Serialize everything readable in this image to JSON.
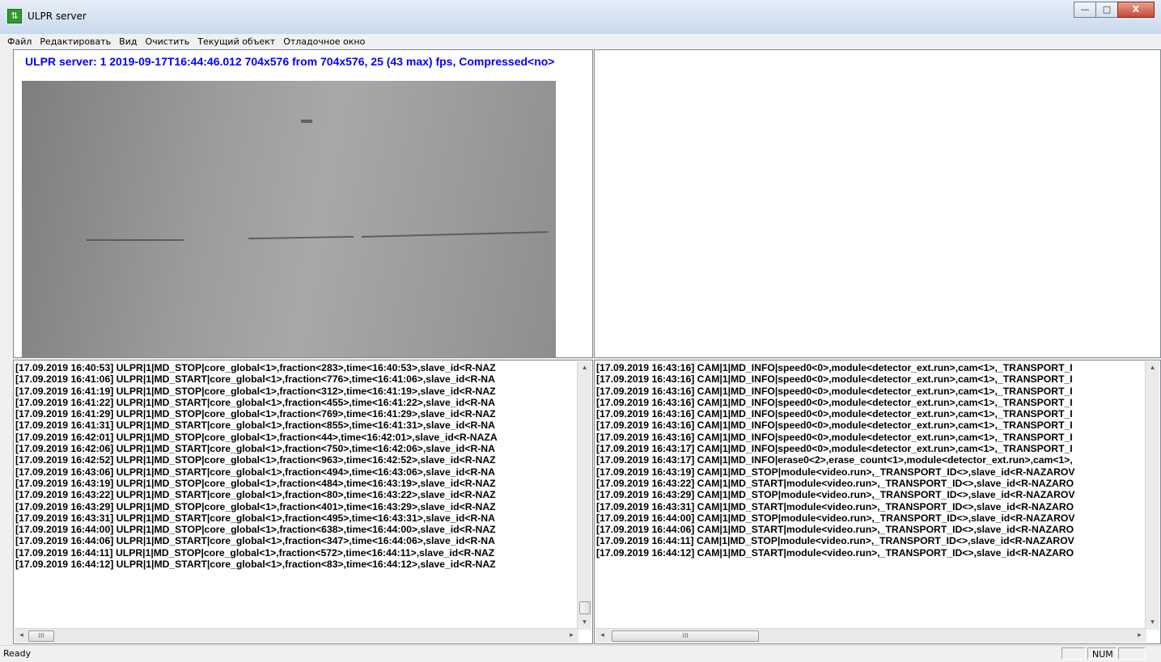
{
  "window": {
    "title": "ULPR server",
    "minimize": "—",
    "maximize": "□",
    "close": "X"
  },
  "menu": [
    "Файл",
    "Редактировать",
    "Вид",
    "Очистить",
    "Текущий объект",
    "Отладочное окно"
  ],
  "video": {
    "caption": "ULPR server: 1 2019-09-17T16:44:46.012 704x576 from 704x576, 25 (43 max) fps, Compressed<no>"
  },
  "log_left": [
    "[17.09.2019 16:40:53] ULPR|1|MD_STOP|core_global<1>,fraction<283>,time<16:40:53>,slave_id<R-NAZ",
    "[17.09.2019 16:41:06] ULPR|1|MD_START|core_global<1>,fraction<776>,time<16:41:06>,slave_id<R-NA",
    "[17.09.2019 16:41:19] ULPR|1|MD_STOP|core_global<1>,fraction<312>,time<16:41:19>,slave_id<R-NAZ",
    "[17.09.2019 16:41:22] ULPR|1|MD_START|core_global<1>,fraction<455>,time<16:41:22>,slave_id<R-NA",
    "[17.09.2019 16:41:29] ULPR|1|MD_STOP|core_global<1>,fraction<769>,time<16:41:29>,slave_id<R-NAZ",
    "[17.09.2019 16:41:31] ULPR|1|MD_START|core_global<1>,fraction<855>,time<16:41:31>,slave_id<R-NA",
    "[17.09.2019 16:42:01] ULPR|1|MD_STOP|core_global<1>,fraction<44>,time<16:42:01>,slave_id<R-NAZA",
    "[17.09.2019 16:42:06] ULPR|1|MD_START|core_global<1>,fraction<750>,time<16:42:06>,slave_id<R-NA",
    "[17.09.2019 16:42:52] ULPR|1|MD_STOP|core_global<1>,fraction<963>,time<16:42:52>,slave_id<R-NAZ",
    "[17.09.2019 16:43:06] ULPR|1|MD_START|core_global<1>,fraction<494>,time<16:43:06>,slave_id<R-NA",
    "[17.09.2019 16:43:19] ULPR|1|MD_STOP|core_global<1>,fraction<484>,time<16:43:19>,slave_id<R-NAZ",
    "[17.09.2019 16:43:22] ULPR|1|MD_START|core_global<1>,fraction<80>,time<16:43:22>,slave_id<R-NAZ",
    "[17.09.2019 16:43:29] ULPR|1|MD_STOP|core_global<1>,fraction<401>,time<16:43:29>,slave_id<R-NAZ",
    "[17.09.2019 16:43:31] ULPR|1|MD_START|core_global<1>,fraction<495>,time<16:43:31>,slave_id<R-NA",
    "[17.09.2019 16:44:00] ULPR|1|MD_STOP|core_global<1>,fraction<638>,time<16:44:00>,slave_id<R-NAZ",
    "[17.09.2019 16:44:06] ULPR|1|MD_START|core_global<1>,fraction<347>,time<16:44:06>,slave_id<R-NA",
    "[17.09.2019 16:44:11] ULPR|1|MD_STOP|core_global<1>,fraction<572>,time<16:44:11>,slave_id<R-NAZ",
    "[17.09.2019 16:44:12] ULPR|1|MD_START|core_global<1>,fraction<83>,time<16:44:12>,slave_id<R-NAZ"
  ],
  "log_right": [
    "[17.09.2019 16:43:16] CAM|1|MD_INFO|speed0<0>,module<detector_ext.run>,cam<1>,_TRANSPORT_I",
    "[17.09.2019 16:43:16] CAM|1|MD_INFO|speed0<0>,module<detector_ext.run>,cam<1>,_TRANSPORT_I",
    "[17.09.2019 16:43:16] CAM|1|MD_INFO|speed0<0>,module<detector_ext.run>,cam<1>,_TRANSPORT_I",
    "[17.09.2019 16:43:16] CAM|1|MD_INFO|speed0<0>,module<detector_ext.run>,cam<1>,_TRANSPORT_I",
    "[17.09.2019 16:43:16] CAM|1|MD_INFO|speed0<0>,module<detector_ext.run>,cam<1>,_TRANSPORT_I",
    "[17.09.2019 16:43:16] CAM|1|MD_INFO|speed0<0>,module<detector_ext.run>,cam<1>,_TRANSPORT_I",
    "[17.09.2019 16:43:16] CAM|1|MD_INFO|speed0<0>,module<detector_ext.run>,cam<1>,_TRANSPORT_I",
    "[17.09.2019 16:43:17] CAM|1|MD_INFO|speed0<0>,module<detector_ext.run>,cam<1>,_TRANSPORT_I",
    "[17.09.2019 16:43:17] CAM|1|MD_INFO|erase0<2>,erase_count<1>,module<detector_ext.run>,cam<1>,",
    "[17.09.2019 16:43:19] CAM|1|MD_STOP|module<video.run>,_TRANSPORT_ID<>,slave_id<R-NAZAROV",
    "[17.09.2019 16:43:22] CAM|1|MD_START|module<video.run>,_TRANSPORT_ID<>,slave_id<R-NAZARO",
    "[17.09.2019 16:43:29] CAM|1|MD_STOP|module<video.run>,_TRANSPORT_ID<>,slave_id<R-NAZAROV",
    "[17.09.2019 16:43:31] CAM|1|MD_START|module<video.run>,_TRANSPORT_ID<>,slave_id<R-NAZARO",
    "[17.09.2019 16:44:00] CAM|1|MD_STOP|module<video.run>,_TRANSPORT_ID<>,slave_id<R-NAZAROV",
    "[17.09.2019 16:44:06] CAM|1|MD_START|module<video.run>,_TRANSPORT_ID<>,slave_id<R-NAZARO",
    "[17.09.2019 16:44:11] CAM|1|MD_STOP|module<video.run>,_TRANSPORT_ID<>,slave_id<R-NAZAROV",
    "[17.09.2019 16:44:12] CAM|1|MD_START|module<video.run>,_TRANSPORT_ID<>,slave_id<R-NAZARO"
  ],
  "scroll": {
    "thumb_grip": "III",
    "left_arrow": "◂",
    "right_arrow": "▸",
    "up_arrow": "▴",
    "down_arrow": "▾"
  },
  "status": {
    "text": "Ready",
    "num": "NUM"
  },
  "colors": {
    "caption": "#0000ff",
    "titlebar_top": "#e7eef8",
    "titlebar_bottom": "#c9d9ee"
  }
}
